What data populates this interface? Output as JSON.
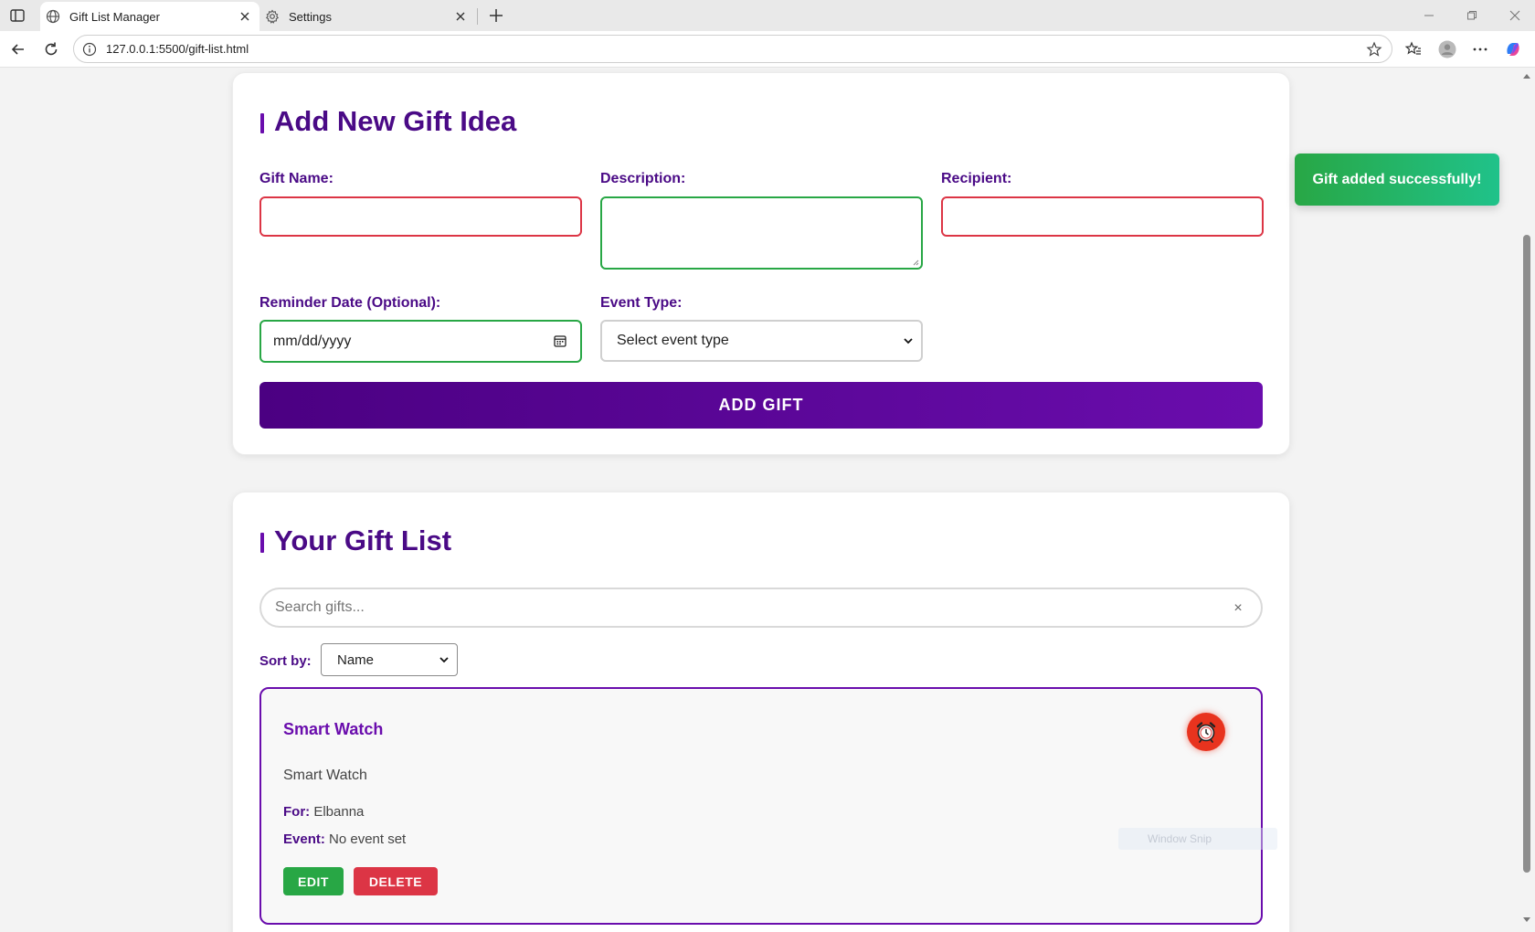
{
  "browser": {
    "tabs": [
      {
        "title": "Gift List Manager",
        "icon": "globe-icon",
        "active": true
      },
      {
        "title": "Settings",
        "icon": "gear-icon",
        "active": false
      }
    ],
    "url": "127.0.0.1:5500/gift-list.html"
  },
  "form": {
    "title": "Add New Gift Idea",
    "gift_name_label": "Gift Name:",
    "gift_name_value": "",
    "description_label": "Description:",
    "description_value": "",
    "recipient_label": "Recipient:",
    "recipient_value": "",
    "reminder_label": "Reminder Date (Optional):",
    "reminder_placeholder": "mm/dd/yyyy",
    "event_label": "Event Type:",
    "event_selected": "Select event type",
    "submit_label": "ADD GIFT"
  },
  "list": {
    "title": "Your Gift List",
    "search_placeholder": "Search gifts...",
    "clear_symbol": "×",
    "sort_label": "Sort by:",
    "sort_selected": "Name",
    "items": [
      {
        "name": "Smart Watch",
        "description": "Smart Watch",
        "for_label": "For:",
        "recipient": "Elbanna",
        "event_label": "Event:",
        "event": "No event set",
        "edit_label": "EDIT",
        "delete_label": "DELETE"
      }
    ]
  },
  "toast": {
    "message": "Gift added successfully!"
  },
  "overlay": {
    "snip_text": "Window Snip"
  },
  "colors": {
    "primary": "#4b0082",
    "accent": "#6a0dad",
    "success": "#28a745",
    "danger": "#dc3545"
  }
}
